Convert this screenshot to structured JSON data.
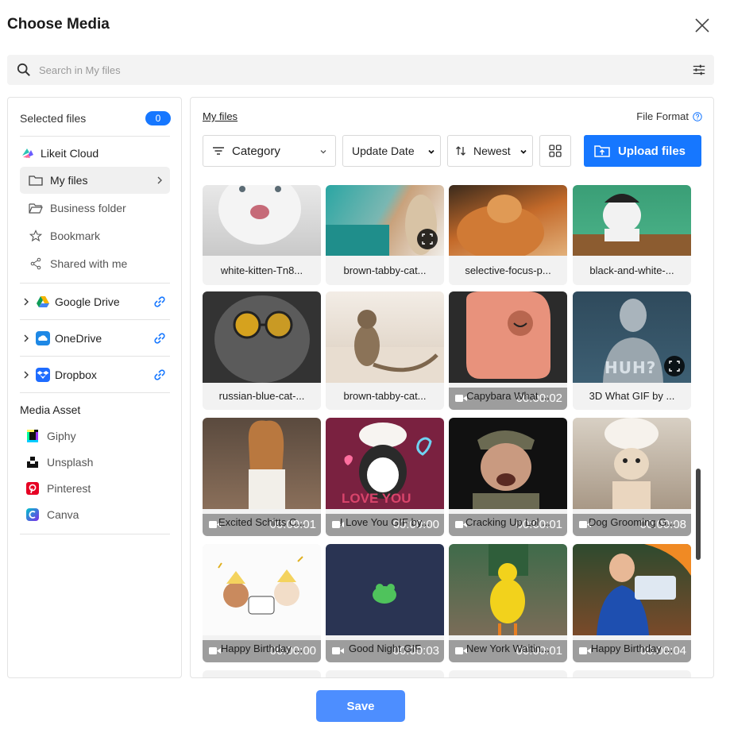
{
  "dialog": {
    "title": "Choose Media"
  },
  "search": {
    "placeholder": "Search in My files"
  },
  "sidebar": {
    "selected_label": "Selected files",
    "selected_count": "0",
    "cloud_name": "Likeit Cloud",
    "items": [
      {
        "label": "My files",
        "icon": "folder-icon"
      },
      {
        "label": "Business folder",
        "icon": "folder-open-icon"
      },
      {
        "label": "Bookmark",
        "icon": "star-icon"
      },
      {
        "label": "Shared with me",
        "icon": "share-icon"
      }
    ],
    "drives": [
      {
        "label": "Google Drive",
        "icon": "google-drive-icon"
      },
      {
        "label": "OneDrive",
        "icon": "onedrive-icon"
      },
      {
        "label": "Dropbox",
        "icon": "dropbox-icon"
      }
    ],
    "media_asset_title": "Media Asset",
    "assets": [
      {
        "label": "Giphy",
        "icon": "giphy-icon"
      },
      {
        "label": "Unsplash",
        "icon": "unsplash-icon"
      },
      {
        "label": "Pinterest",
        "icon": "pinterest-icon"
      },
      {
        "label": "Canva",
        "icon": "canva-icon"
      }
    ]
  },
  "main": {
    "breadcrumb": "My files",
    "file_format_label": "File Format",
    "category_label": "Category",
    "sort_field_options": [
      "Update Date"
    ],
    "sort_field": "Update Date",
    "sort_order_options": [
      "Newest"
    ],
    "sort_order": "Newest",
    "upload_label": "Upload files",
    "files": [
      {
        "caption": "white-kitten-Tn8...",
        "duration": "",
        "expand": false
      },
      {
        "caption": "brown-tabby-cat...",
        "duration": "",
        "expand": true
      },
      {
        "caption": "selective-focus-p...",
        "duration": "",
        "expand": false
      },
      {
        "caption": "black-and-white-...",
        "duration": "",
        "expand": false
      },
      {
        "caption": "russian-blue-cat-...",
        "duration": "",
        "expand": false
      },
      {
        "caption": "brown-tabby-cat...",
        "duration": "",
        "expand": false
      },
      {
        "caption": "Capybara What ...",
        "duration": "00:00:02",
        "expand": false
      },
      {
        "caption": "3D What GIF by ...",
        "duration": "",
        "expand": true,
        "overlay_text": "HUH?"
      },
      {
        "caption": "Excited Schitts C...",
        "duration": "00:00:01",
        "expand": false
      },
      {
        "caption": "I Love You GIF by...",
        "duration": "00:00:00",
        "expand": false,
        "overlay_text": "LOVE YOU"
      },
      {
        "caption": "Cracking Up Lol ...",
        "duration": "00:00:01",
        "expand": false
      },
      {
        "caption": "Dog Grooming G...",
        "duration": "00:00:08",
        "expand": false
      },
      {
        "caption": "Happy Birthday ...",
        "duration": "00:00:00",
        "expand": false
      },
      {
        "caption": "Good Night GIF",
        "duration": "00:00:03",
        "expand": false
      },
      {
        "caption": "New York Waitin...",
        "duration": "00:00:01",
        "expand": false
      },
      {
        "caption": "Happy Birthday ...",
        "duration": "00:00:04",
        "expand": false
      }
    ]
  },
  "footer": {
    "save_label": "Save"
  },
  "colors": {
    "accent": "#1677ff",
    "save": "#4d8eff",
    "badge": "#1677ff"
  }
}
